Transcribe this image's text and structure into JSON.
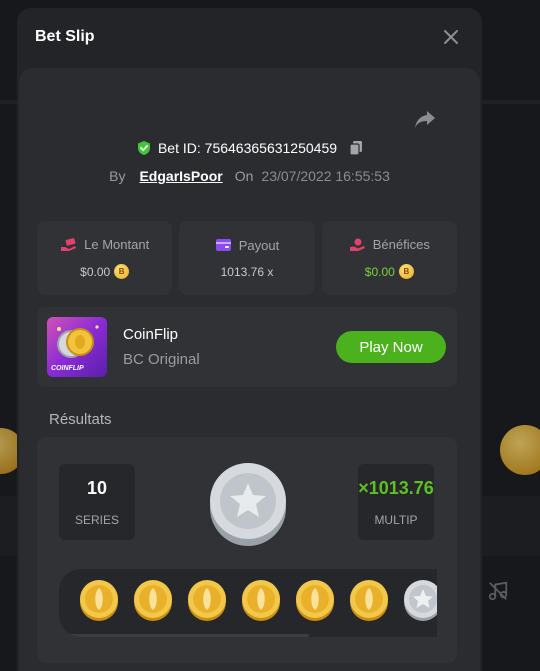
{
  "modal": {
    "title": "Bet Slip"
  },
  "bet": {
    "id_label": "Bet ID: 75646365631250459",
    "by_label": "By",
    "username": "EdgarIsPoor",
    "on_label": "On",
    "datetime": "23/07/2022 16:55:53"
  },
  "stats": [
    {
      "label": "Le Montant",
      "value": "$0.00",
      "icon": "money-hand-icon",
      "color": "#e2416b"
    },
    {
      "label": "Payout",
      "value": "1013.76 x",
      "icon": "wallet-icon",
      "color": "#8a4cf0"
    },
    {
      "label": "Bénéfices",
      "value": "$0.00",
      "icon": "profit-hand-icon",
      "color": "#e2416b"
    }
  ],
  "game": {
    "name": "CoinFlip",
    "subtitle": "BC Original",
    "thumb_label": "COINFLIP",
    "play_label": "Play Now"
  },
  "results": {
    "label": "Résultats",
    "series_value": "10",
    "series_label": "SERIES",
    "multiplier_value": "×1013.76",
    "multiplier_label": "MULTIP",
    "coins": [
      "gold",
      "gold",
      "gold",
      "gold",
      "gold",
      "gold",
      "silver"
    ]
  },
  "colors": {
    "accent_green": "#4bb21e",
    "multiplier_green": "#5dc023",
    "panel": "#2b2c30"
  }
}
